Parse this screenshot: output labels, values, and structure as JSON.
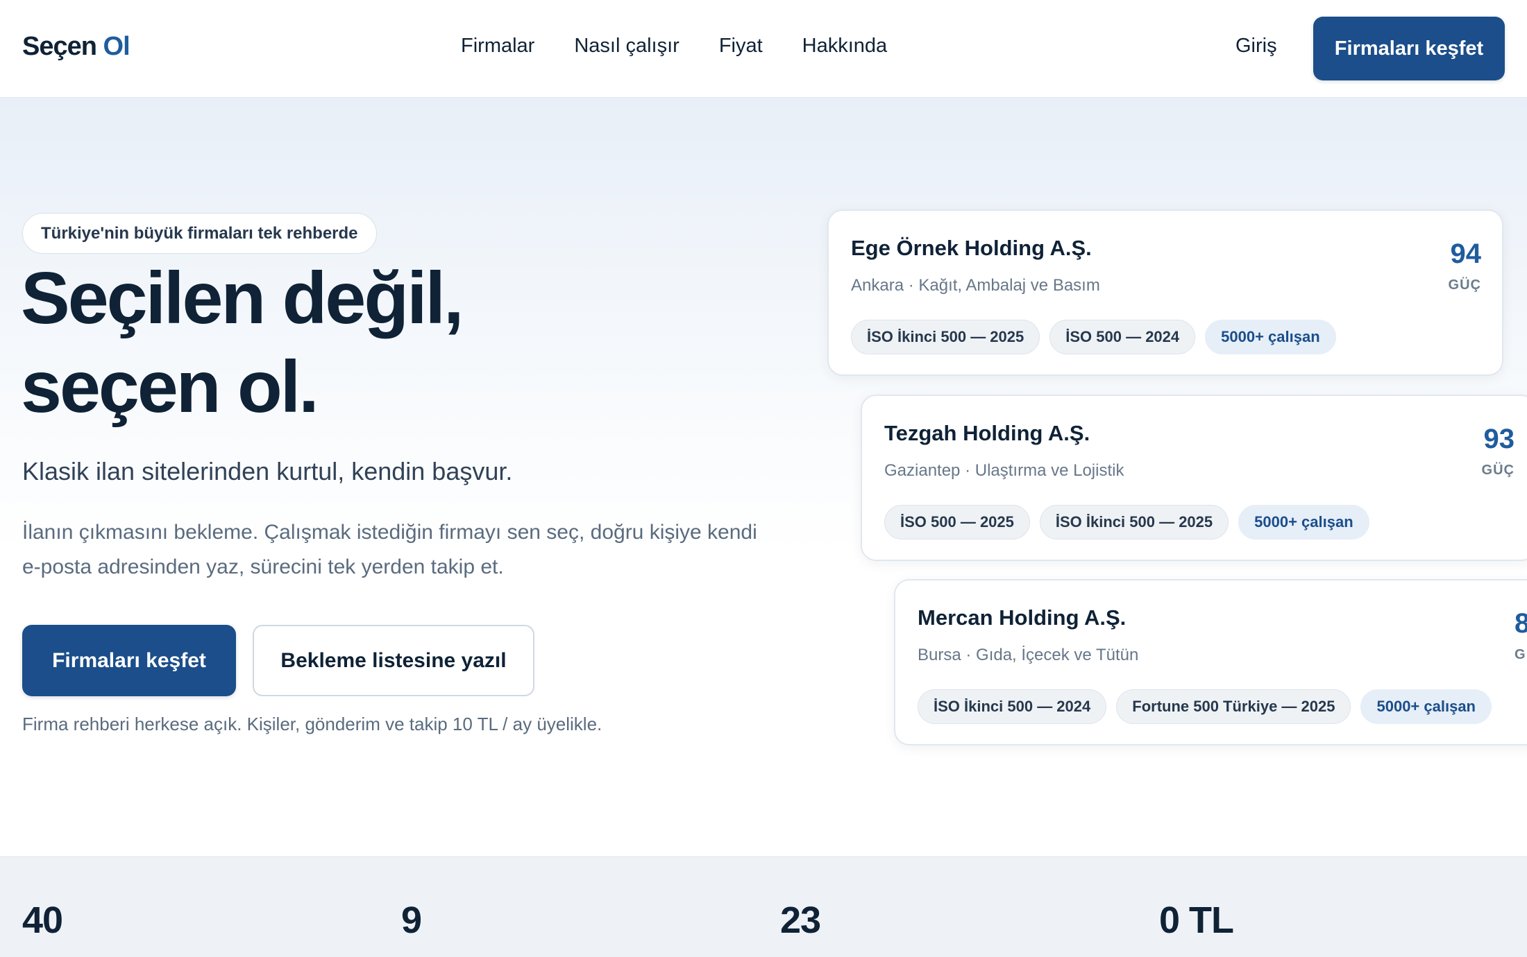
{
  "header": {
    "logo_primary": "Seçen",
    "logo_accent": "Ol",
    "nav": [
      "Firmalar",
      "Nasıl çalışır",
      "Fiyat",
      "Hakkında"
    ],
    "login": "Giriş",
    "cta": "Firmaları keşfet"
  },
  "hero": {
    "pill": "Türkiye'nin büyük firmaları tek rehberde",
    "title_line1": "Seçilen değil,",
    "title_line2": "seçen ol.",
    "subtitle": "Klasik ilan sitelerinden kurtul, kendin başvur.",
    "description": "İlanın çıkmasını bekleme. Çalışmak istediğin firmayı sen seç, doğru kişiye kendi e-posta adresinden yaz, sürecini tek yerden takip et.",
    "primary_button": "Firmaları keşfet",
    "secondary_button": "Bekleme listesine yazıl",
    "note": "Firma rehberi herkese açık. Kişiler, gönderim ve takip 10 TL / ay üyelikle."
  },
  "companies": [
    {
      "name": "Ege Örnek Holding A.Ş.",
      "meta": "Ankara · Kağıt, Ambalaj ve Basım",
      "score": "94",
      "score_label": "GÜÇ",
      "tags": [
        "İSO İkinci 500 — 2025",
        "İSO 500 — 2024",
        "5000+ çalışan"
      ]
    },
    {
      "name": "Tezgah Holding A.Ş.",
      "meta": "Gaziantep · Ulaştırma ve Lojistik",
      "score": "93",
      "score_label": "GÜÇ",
      "tags": [
        "İSO 500 — 2025",
        "İSO İkinci 500 — 2025",
        "5000+ çalışan"
      ]
    },
    {
      "name": "Mercan Holding A.Ş.",
      "meta": "Bursa · Gıda, İçecek ve Tütün",
      "score": "8",
      "score_label": "G",
      "tags": [
        "İSO İkinci 500 — 2024",
        "Fortune 500 Türkiye — 2025",
        "5000+ çalışan"
      ]
    }
  ],
  "stats": [
    {
      "value": "40"
    },
    {
      "value": "9"
    },
    {
      "value": "23"
    },
    {
      "value": "0 TL"
    }
  ],
  "colors": {
    "brand": "#1b4e8a",
    "accent": "#1f5c9e",
    "text": "#0f2236",
    "muted": "#5a6b7e"
  }
}
